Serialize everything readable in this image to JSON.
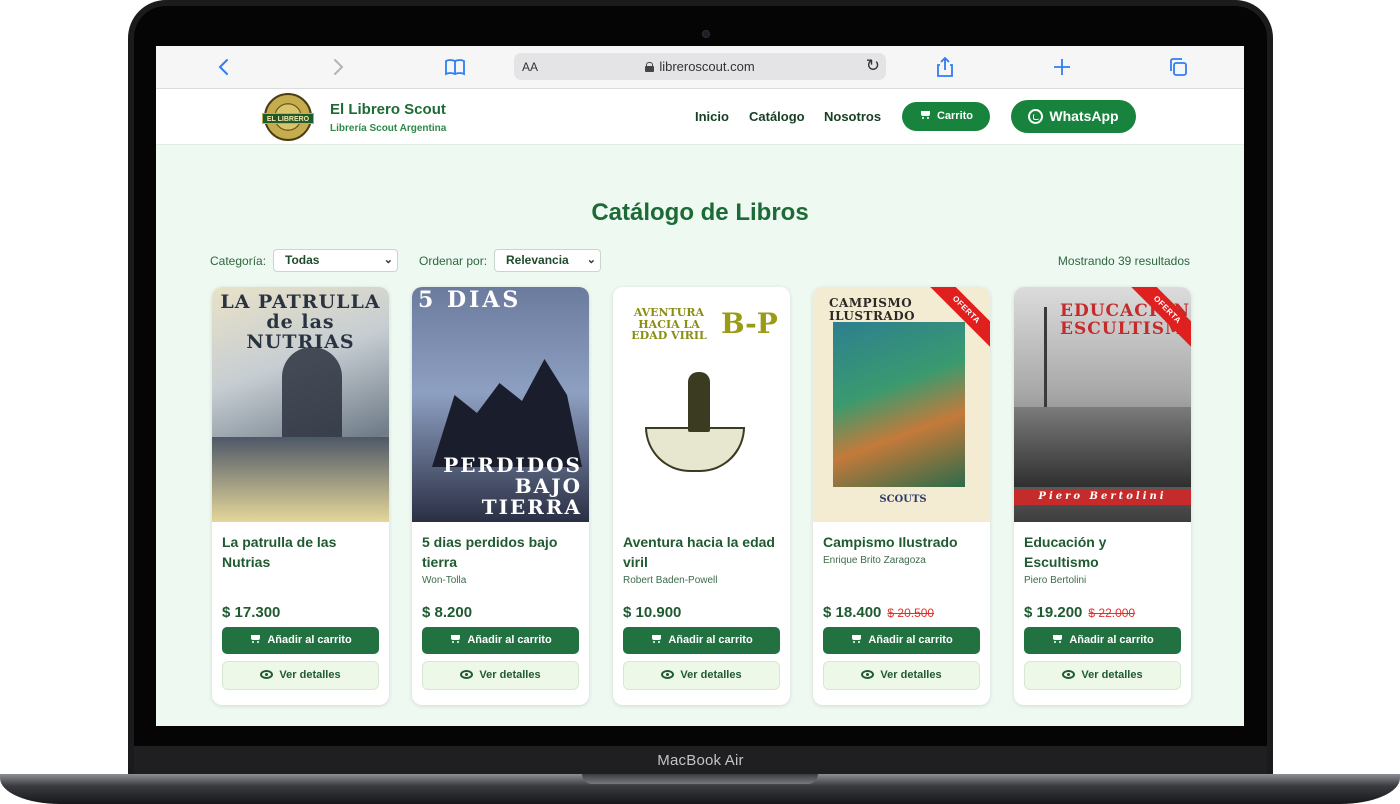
{
  "device": {
    "label": "MacBook Air"
  },
  "browser": {
    "url": "libreroscout.com",
    "aa_label": "AA",
    "icons": [
      "back-icon",
      "forward-icon",
      "bookmarks-icon",
      "reload-icon",
      "share-icon",
      "new-tab-icon",
      "tabs-icon"
    ]
  },
  "header": {
    "brand_title": "El Librero Scout",
    "brand_subtitle": "Librería Scout Argentina",
    "logo_text": "EL LIBRERO",
    "nav": [
      "Inicio",
      "Catálogo",
      "Nosotros"
    ],
    "cart_label": "Carrito",
    "whatsapp_label": "WhatsApp"
  },
  "catalog": {
    "title": "Catálogo de Libros",
    "category_label": "Categoría:",
    "category_value": "Todas",
    "sort_label": "Ordenar por:",
    "sort_value": "Relevancia",
    "results_text": "Mostrando 39 resultados",
    "add_label": "Añadir al carrito",
    "details_label": "Ver detalles",
    "offer_label": "OFERTA",
    "books": [
      {
        "title_line1": "La patrulla de las",
        "title_line2": "Nutrias",
        "author": "",
        "price": "$ 17.300",
        "old_price": "",
        "cover_text": "LA PATRULLA de las NUTRIAS"
      },
      {
        "title_line1": "5 dias perdidos bajo",
        "title_line2": "tierra",
        "author": "Won-Tolla",
        "price": "$ 8.200",
        "old_price": "",
        "cover_top": "5 DIAS",
        "cover_bottom": "PERDIDOS BAJO TIERRA"
      },
      {
        "title_line1": "Aventura hacia la edad",
        "title_line2": "viril",
        "author": "Robert Baden-Powell",
        "price": "$ 10.900",
        "old_price": "",
        "cover_top": "AVENTURA HACIA LA EDAD VIRIL",
        "cover_side": "B-P"
      },
      {
        "title_line1": "Campismo Ilustrado",
        "title_line2": "",
        "author": "Enrique Brito Zaragoza",
        "price": "$ 18.400",
        "old_price": "$ 20.500",
        "cover_top": "CAMPISMO ILUSTRADO",
        "cover_bottom": "SCOUTS"
      },
      {
        "title_line1": "Educación y",
        "title_line2": "Escultismo",
        "author": "Piero Bertolini",
        "price": "$ 19.200",
        "old_price": "$ 22.000",
        "cover_top": "EDUCACION ESCULTISMO",
        "cover_bottom": "Piero Bertolini"
      }
    ]
  },
  "colors": {
    "brand_green": "#18833c",
    "title_green": "#1c6a35",
    "offer_red": "#e01f1f",
    "page_bg": "#eef9f1"
  }
}
